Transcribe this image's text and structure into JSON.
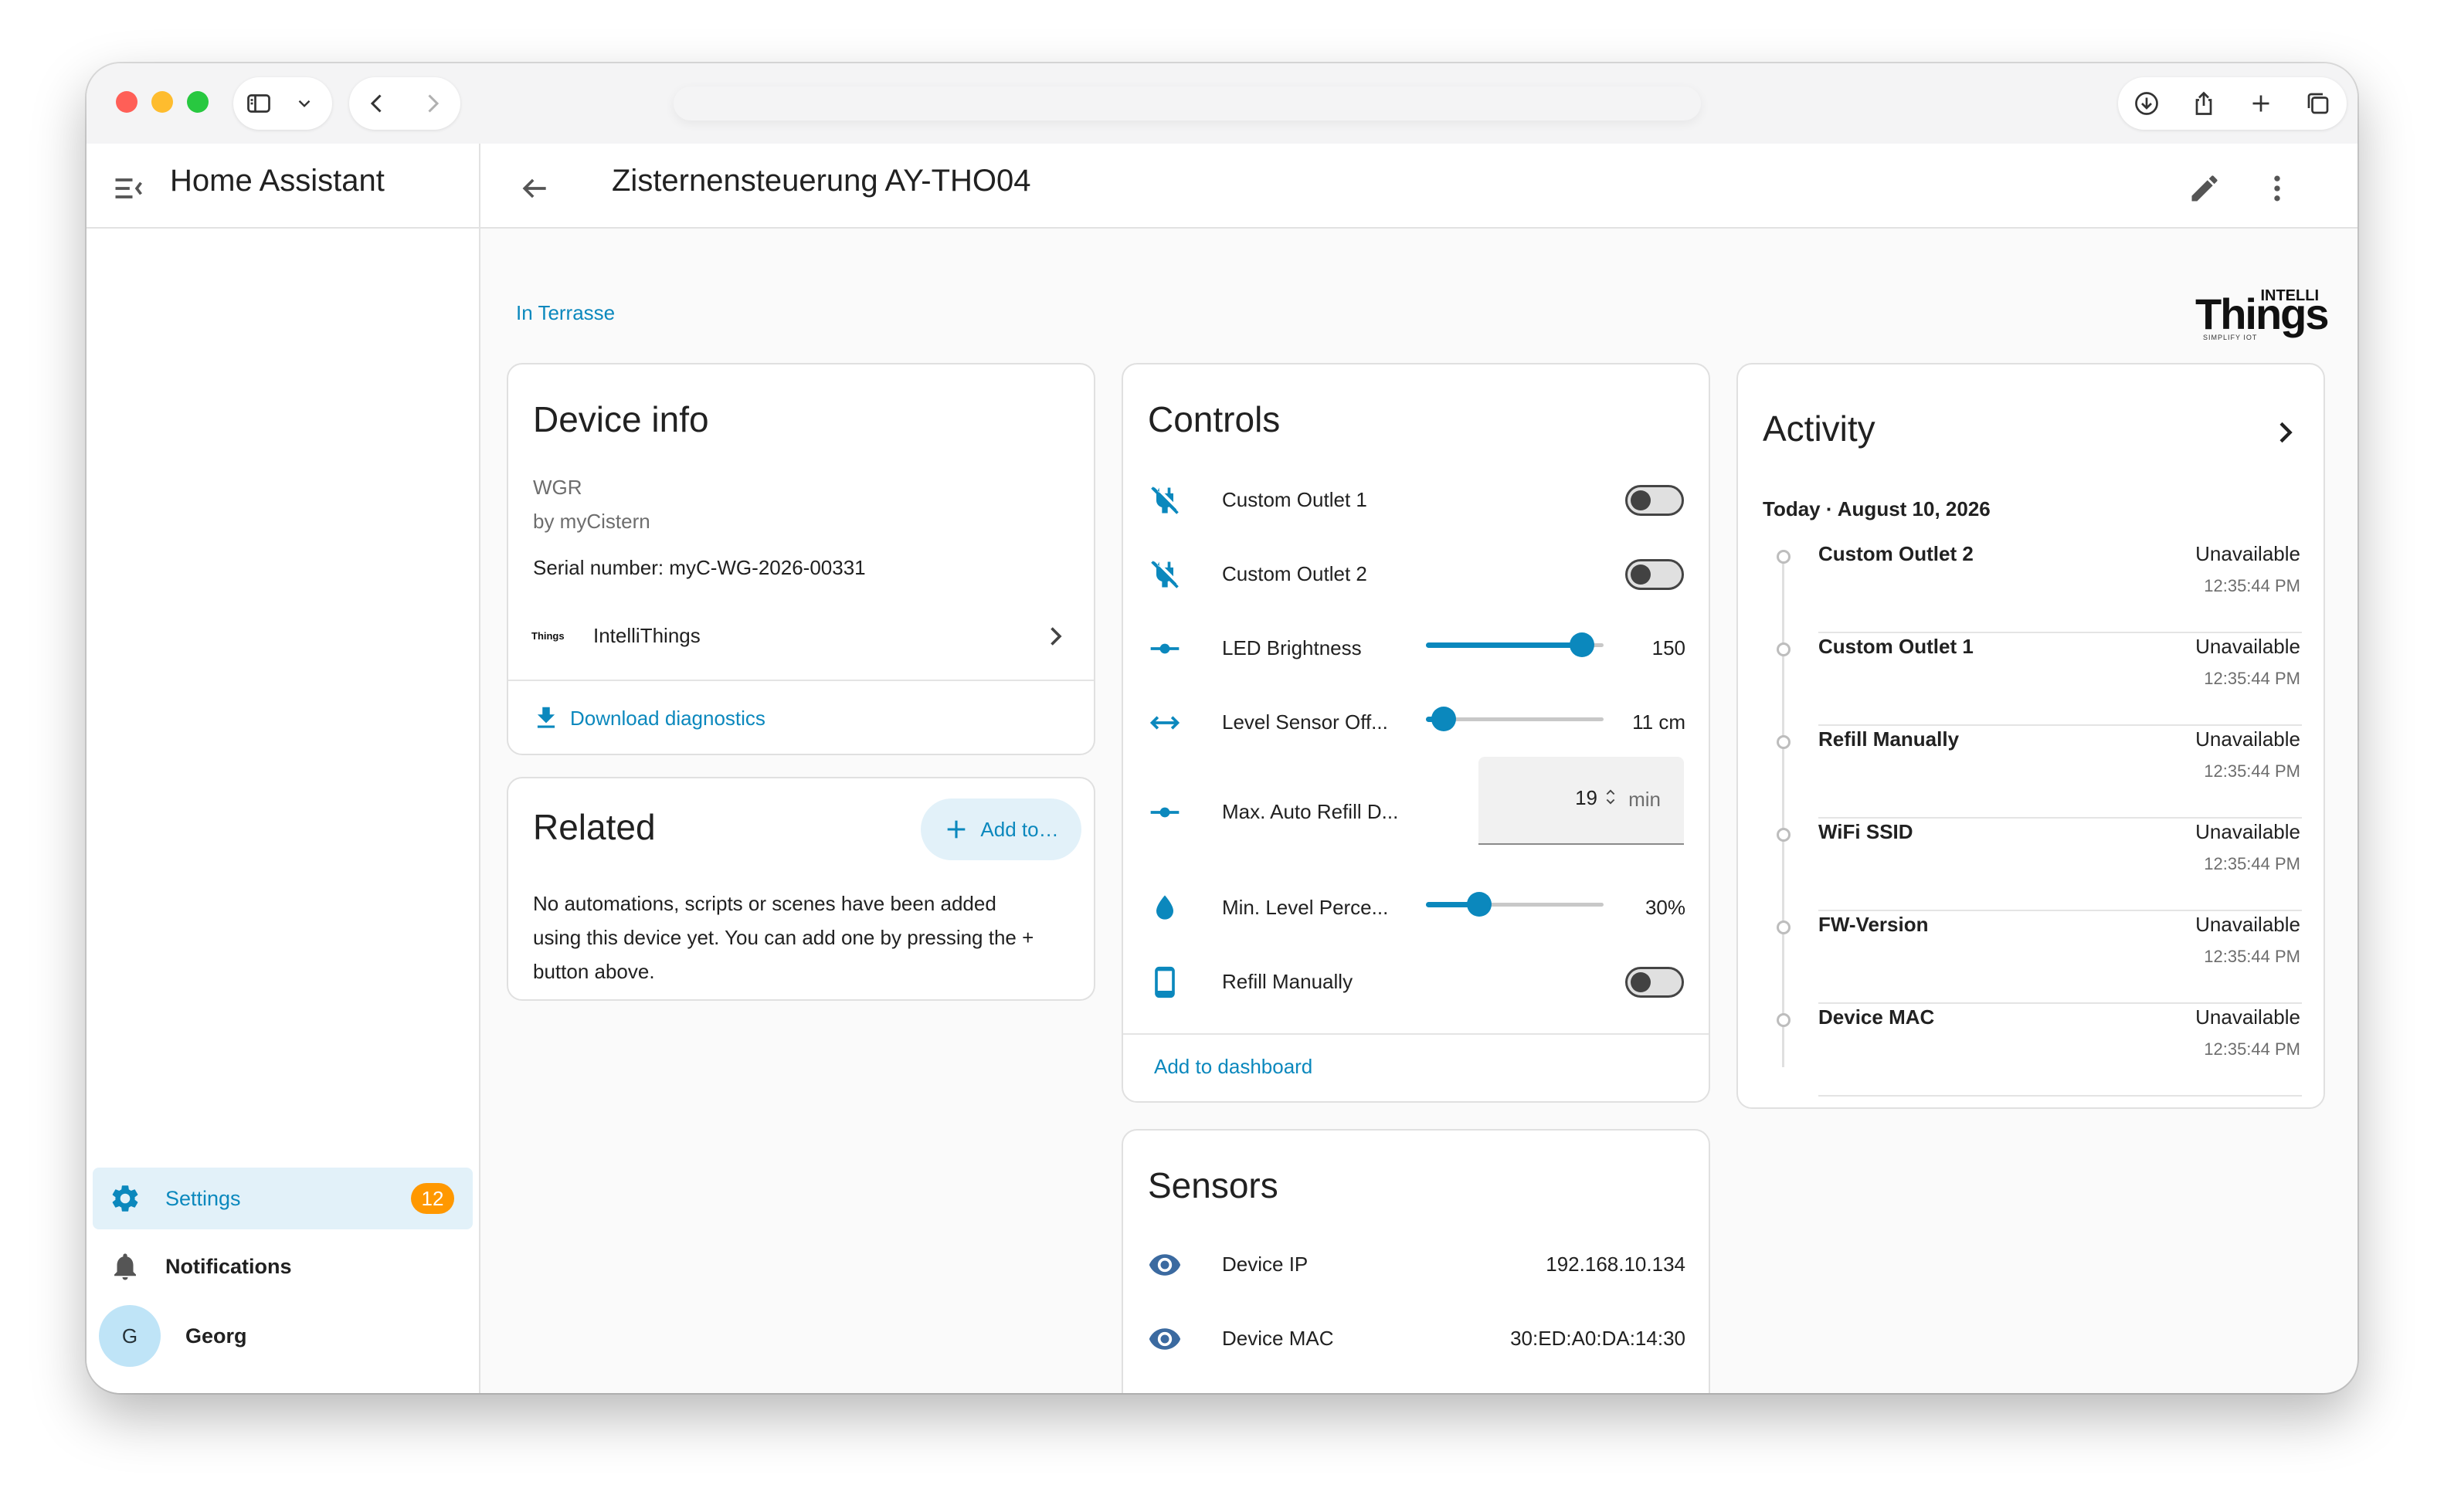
{
  "app": {
    "title": "Home Assistant",
    "page_title": "Zisternensteuerung AY-THO04"
  },
  "sidebar": {
    "settings": {
      "label": "Settings",
      "badge": "12"
    },
    "notifications": {
      "label": "Notifications"
    },
    "user": {
      "initial": "G",
      "name": "Georg"
    }
  },
  "area_link": "In Terrasse",
  "brand": {
    "top": "INTELLI",
    "name": "Things",
    "tagline": "SIMPLIFY IOT"
  },
  "device_info": {
    "title": "Device info",
    "model": "WGR",
    "manufacturer": "by myCistern",
    "serial": "Serial number: myC-WG-2026-00331",
    "integration": "IntelliThings",
    "download": "Download diagnostics"
  },
  "related": {
    "title": "Related",
    "add_label": "Add to…",
    "text_line1": "No automations, scripts or scenes have been added",
    "text_line2": "using this device yet. You can add one by pressing the +",
    "text_line3": "button above."
  },
  "controls": {
    "title": "Controls",
    "rows": [
      {
        "label": "Custom Outlet 1",
        "kind": "toggle",
        "state": "off",
        "icon": "power-plug-off-icon"
      },
      {
        "label": "Custom Outlet 2",
        "kind": "toggle",
        "state": "off",
        "icon": "power-plug-off-icon"
      },
      {
        "label": "LED Brightness",
        "kind": "slider",
        "value": "150",
        "fraction": 0.88,
        "icon": "ray-vertex-icon"
      },
      {
        "label": "Level Sensor Off...",
        "kind": "slider",
        "value": "11 cm",
        "fraction": 0.1,
        "icon": "arrow-left-right-icon"
      },
      {
        "label": "Max. Auto Refill D...",
        "kind": "number",
        "value": "19",
        "unit": "min",
        "icon": "ray-vertex-icon"
      },
      {
        "label": "Min. Level Perce...",
        "kind": "slider",
        "value": "30%",
        "fraction": 0.3,
        "icon": "water-drop-icon"
      },
      {
        "label": "Refill Manually",
        "kind": "toggle",
        "state": "off",
        "icon": "cellphone-icon"
      }
    ],
    "add_to_dashboard": "Add to dashboard"
  },
  "sensors": {
    "title": "Sensors",
    "rows": [
      {
        "label": "Device IP",
        "value": "192.168.10.134",
        "icon": "eye-icon"
      },
      {
        "label": "Device MAC",
        "value": "30:ED:A0:DA:14:30",
        "icon": "eye-icon"
      }
    ]
  },
  "activity": {
    "title": "Activity",
    "date": "Today · August 10, 2026",
    "entries": [
      {
        "name": "Custom Outlet 2",
        "state": "Unavailable",
        "time": "12:35:44 PM"
      },
      {
        "name": "Custom Outlet 1",
        "state": "Unavailable",
        "time": "12:35:44 PM"
      },
      {
        "name": "Refill Manually",
        "state": "Unavailable",
        "time": "12:35:44 PM"
      },
      {
        "name": "WiFi SSID",
        "state": "Unavailable",
        "time": "12:35:44 PM"
      },
      {
        "name": "FW-Version",
        "state": "Unavailable",
        "time": "12:35:44 PM"
      },
      {
        "name": "Device MAC",
        "state": "Unavailable",
        "time": "12:35:44 PM"
      }
    ]
  },
  "colors": {
    "accent": "#0b88bd",
    "badge": "#ff9800",
    "settings_bg": "#e2f1f9"
  }
}
